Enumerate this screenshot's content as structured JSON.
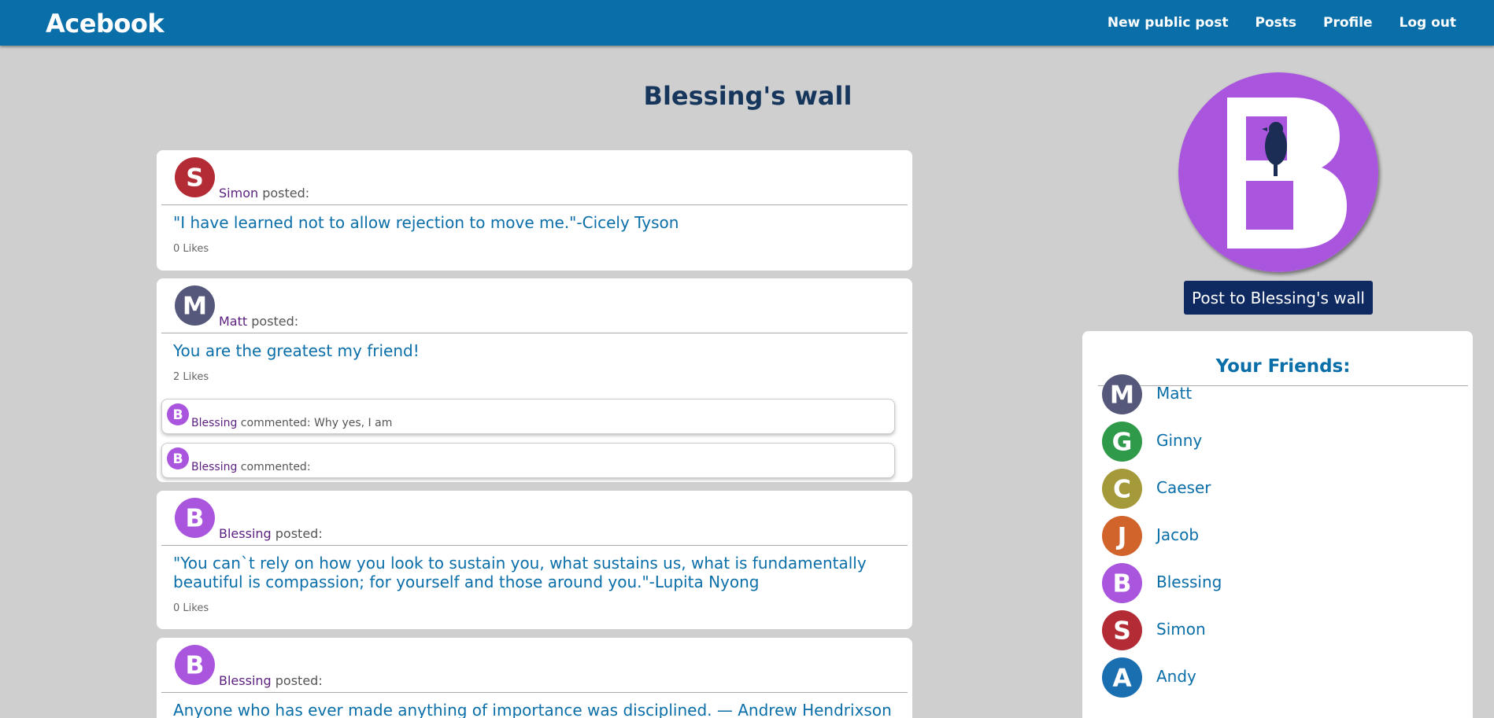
{
  "nav": {
    "logo": "Acebook",
    "links": [
      "New public post",
      "Posts",
      "Profile",
      "Log out"
    ]
  },
  "wall": {
    "title": "Blessing's wall",
    "post_button": "Post to Blessing's wall"
  },
  "posts": [
    {
      "author": "Simon",
      "action": " posted:",
      "text": "\"I have learned not to allow rejection to move me.\"-Cicely Tyson",
      "likes": "0 Likes",
      "avatar_letter": "S",
      "avatar_color": "#b32b35"
    },
    {
      "author": "Matt",
      "action": " posted:",
      "text": "You are the greatest my friend!",
      "likes": "2 Likes",
      "avatar_letter": "M",
      "avatar_color": "#55587a",
      "comments": [
        {
          "author": "Blessing",
          "text": " commented: Why yes, I am"
        },
        {
          "author": "Blessing",
          "text": " commented:"
        }
      ]
    },
    {
      "author": "Blessing",
      "action": " posted:",
      "text": "\"You can`t rely on how you look to sustain you, what sustains us, what is fundamentally beautiful is compassion; for yourself and those around you.\"-Lupita Nyong",
      "likes": "0 Likes",
      "avatar_letter": "B",
      "avatar_color": "#a955dd"
    },
    {
      "author": "Blessing",
      "action": " posted:",
      "text": "Anyone who has ever made anything of importance was disciplined. — Andrew Hendrixson",
      "avatar_letter": "B",
      "avatar_color": "#a955dd"
    }
  ],
  "friends": {
    "title": "Your Friends:",
    "items": [
      {
        "name": "Matt",
        "letter": "M",
        "color": "#55587a"
      },
      {
        "name": "Ginny",
        "letter": "G",
        "color": "#2f9a4a"
      },
      {
        "name": "Caeser",
        "letter": "C",
        "color": "#a49a3a"
      },
      {
        "name": "Jacob",
        "letter": "J",
        "color": "#d0642a"
      },
      {
        "name": "Blessing",
        "letter": "B",
        "color": "#a955dd"
      },
      {
        "name": "Simon",
        "letter": "S",
        "color": "#b32b35"
      },
      {
        "name": "Andy",
        "letter": "A",
        "color": "#1a6fb0"
      }
    ]
  },
  "colors": {
    "navbar": "#0a6ea8",
    "background": "#cfcfcf",
    "link_text": "#0a6ea8",
    "author_text": "#5a1f7e",
    "post_button": "#0e2a61"
  }
}
